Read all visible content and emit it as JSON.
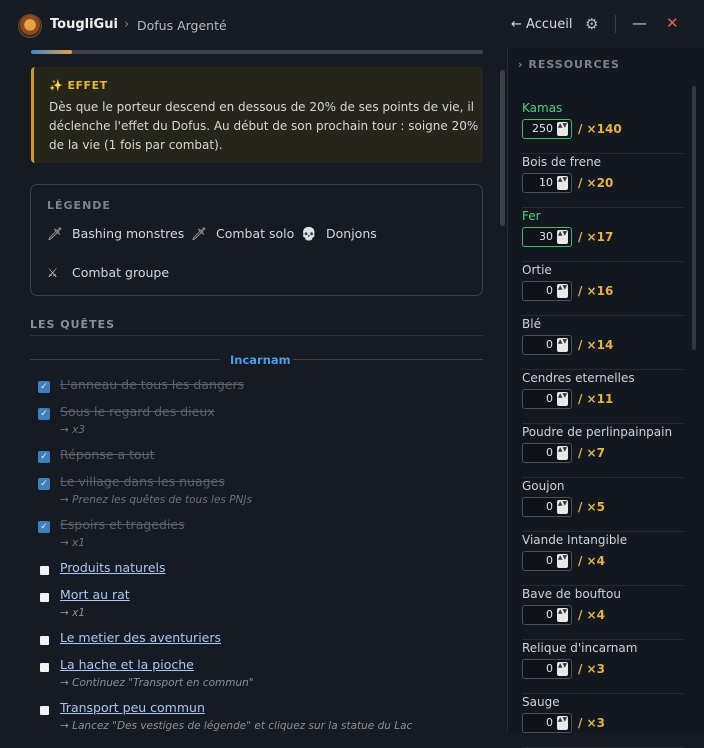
{
  "header": {
    "app_name": "TougliGui",
    "crumb_sep": "›",
    "crumb": "Dofus Argenté",
    "home_label": "← Accueil",
    "settings_glyph": "⚙",
    "minimize_glyph": "—",
    "close_glyph": "✕"
  },
  "progress": {
    "fraction": 0.09
  },
  "effet": {
    "title": "✨ EFFET",
    "text": "Dès que le porteur descend en dessous de 20% de ses points de vie, il déclenche l'effet du Dofus. Au début de son prochain tour : soigne 20% de la vie (1 fois par combat)."
  },
  "legend": {
    "title": "LÉGENDE",
    "items": [
      {
        "icon": "dagger-icon",
        "glyph": "🗡",
        "label": "Bashing monstres"
      },
      {
        "icon": "dagger-icon",
        "glyph": "🗡",
        "label": "Combat solo"
      },
      {
        "icon": "skull-icon",
        "glyph": "💀",
        "label": "Donjons"
      },
      {
        "icon": "crossed-swords-icon",
        "glyph": "⚔",
        "label": "Combat groupe"
      }
    ]
  },
  "quests": {
    "title": "LES QUÊTES",
    "section": "Incarnam",
    "items": [
      {
        "name": "L'anneau de tous les dangers",
        "done": true,
        "note": ""
      },
      {
        "name": "Sous le regard des dieux",
        "done": true,
        "note": "→ x3"
      },
      {
        "name": "Réponse a tout",
        "done": true,
        "note": ""
      },
      {
        "name": "Le village dans les nuages",
        "done": true,
        "note": "→ Prenez les quêtes de tous les PNJs"
      },
      {
        "name": "Espoirs et tragedies",
        "done": true,
        "note": "→ x1"
      },
      {
        "name": "Produits naturels",
        "done": false,
        "note": ""
      },
      {
        "name": "Mort au rat",
        "done": false,
        "note": "→ x1"
      },
      {
        "name": "Le metier des aventuriers",
        "done": false,
        "note": ""
      },
      {
        "name": "La hache et la pioche",
        "done": false,
        "note": "→ Continuez \"Transport en commun\""
      },
      {
        "name": "Transport peu commun",
        "done": false,
        "note": "→ Lancez \"Des vestiges de légende\" et cliquez sur la statue du Lac"
      }
    ]
  },
  "resources": {
    "title": "› RESSOURCES",
    "spin_glyph": "▲▼",
    "items": [
      {
        "name": "Kamas",
        "value": "250",
        "target": "/ ×140",
        "complete": true
      },
      {
        "name": "Bois de frene",
        "value": "10",
        "target": "/ ×20",
        "complete": false
      },
      {
        "name": "Fer",
        "value": "30",
        "target": "/ ×17",
        "complete": true
      },
      {
        "name": "Ortie",
        "value": "0",
        "target": "/ ×16",
        "complete": false
      },
      {
        "name": "Blé",
        "value": "0",
        "target": "/ ×14",
        "complete": false
      },
      {
        "name": "Cendres eternelles",
        "value": "0",
        "target": "/ ×11",
        "complete": false
      },
      {
        "name": "Poudre de perlinpainpain",
        "value": "0",
        "target": "/ ×7",
        "complete": false
      },
      {
        "name": "Goujon",
        "value": "0",
        "target": "/ ×5",
        "complete": false
      },
      {
        "name": "Viande Intangible",
        "value": "0",
        "target": "/ ×4",
        "complete": false
      },
      {
        "name": "Bave de bouftou",
        "value": "0",
        "target": "/ ×4",
        "complete": false
      },
      {
        "name": "Relique d'incarnam",
        "value": "0",
        "target": "/ ×3",
        "complete": false
      },
      {
        "name": "Sauge",
        "value": "0",
        "target": "/ ×3",
        "complete": false
      }
    ]
  }
}
